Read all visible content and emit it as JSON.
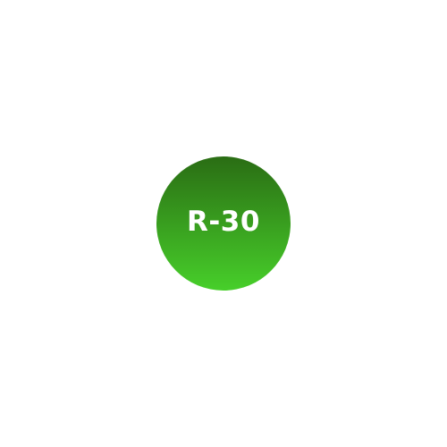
{
  "badge": {
    "label": "R-30",
    "colors": {
      "gradient_top": "#2a6d14",
      "gradient_bottom": "#47cf2a",
      "text": "#ffffff"
    }
  }
}
